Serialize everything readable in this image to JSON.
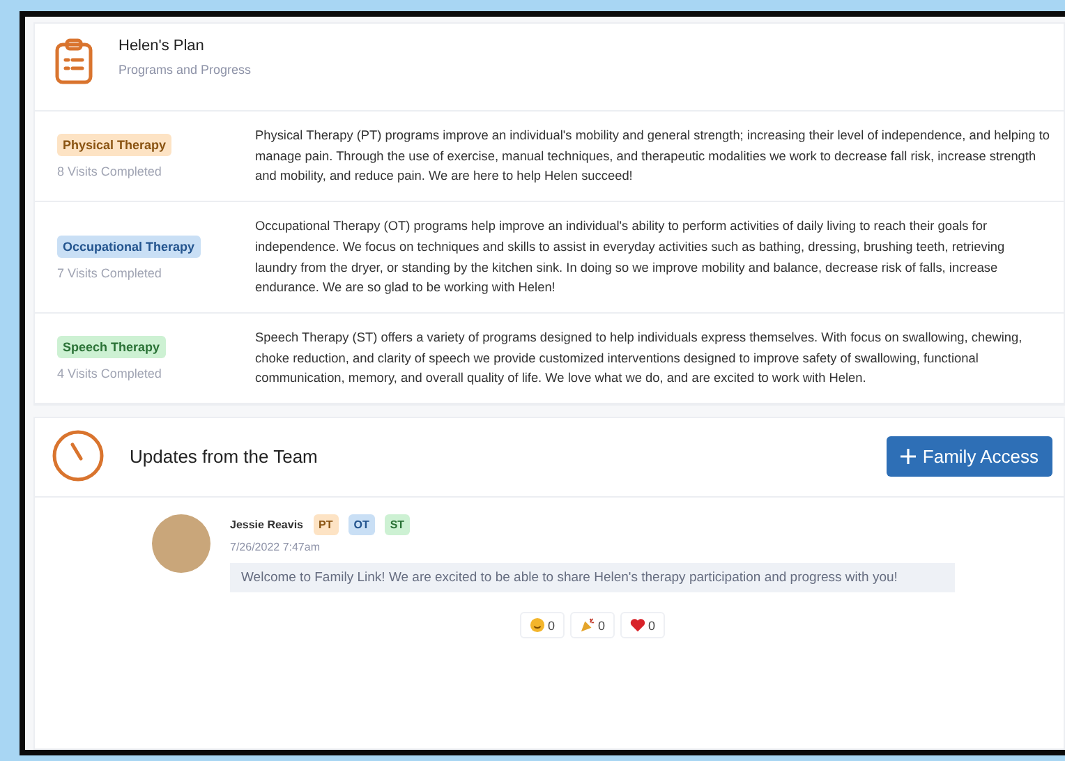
{
  "plan": {
    "title": "Helen's Plan",
    "subtitle": "Programs and Progress",
    "programs": [
      {
        "name": "Physical Therapy",
        "color": "#fde3c4",
        "visits": "8 Visits Completed",
        "description": "Physical Therapy (PT) programs improve an individual's mobility and general strength; increasing their level of independence, and helping to manage pain. Through the use of exercise, manual techniques, and therapeutic modalities we work to decrease fall risk, increase strength and mobility, and reduce pain. We are here to help Helen succeed!"
      },
      {
        "name": "Occupational Therapy",
        "color": "#c9dff5",
        "visits": "7 Visits Completed",
        "description": "Occupational Therapy (OT) programs help improve an individual's ability to perform activities of daily living to reach their goals for independence. We focus on techniques and skills to assist in everyday activities such as bathing, dressing, brushing teeth, retrieving laundry from the dryer, or standing by the kitchen sink. In doing so we improve mobility and balance, decrease risk of falls, increase endurance. We are so glad to be working with Helen!"
      },
      {
        "name": "Speech Therapy",
        "color": "#cdf1d3",
        "visits": "4 Visits Completed",
        "description": "Speech Therapy (ST) offers a variety of programs designed to help individuals express themselves. With focus on swallowing, chewing, choke reduction, and clarity of speech we provide customized interventions designed to improve safety of swallowing, functional communication, memory, and overall quality of life. We love what we do, and are excited to work with Helen."
      }
    ]
  },
  "updates": {
    "title": "Updates from the Team",
    "button": "Family Access",
    "posts": [
      {
        "author": "Jessie Reavis",
        "tags": [
          {
            "label": "PT",
            "color": "#fde3c4"
          },
          {
            "label": "OT",
            "color": "#c9dff5"
          },
          {
            "label": "ST",
            "color": "#cdf1d3"
          }
        ],
        "time": "7/26/2022 7:47am",
        "message": "Welcome to Family Link! We are excited to be able to share Helen's therapy participation and progress with you!",
        "reactions": [
          {
            "kind": "smile",
            "count": "0"
          },
          {
            "kind": "party",
            "count": "0"
          },
          {
            "kind": "heart",
            "count": "0"
          }
        ]
      }
    ]
  }
}
